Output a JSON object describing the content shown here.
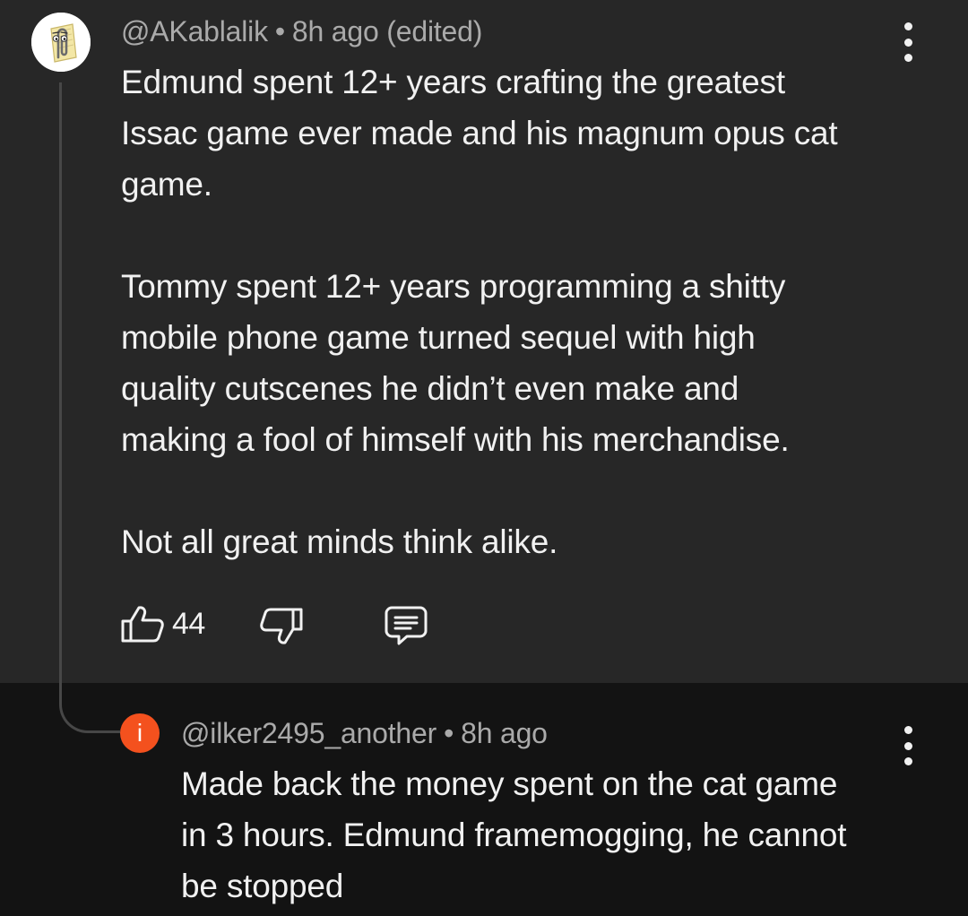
{
  "top_comment": {
    "author": "@AKablalik",
    "separator": "•",
    "timestamp": "8h ago (edited)",
    "avatar_icon": "paperclip-assistant-icon",
    "body_lines": [
      "Edmund spent 12+ years crafting the greatest",
      "Issac game ever made and his magnum opus cat",
      "game.",
      "",
      "Tommy spent 12+ years programming a shitty",
      "mobile phone game turned sequel with high",
      "quality cutscenes he didn’t even make and",
      "making a fool of himself with his merchandise.",
      "",
      "Not all great minds think alike."
    ],
    "like_count": "44",
    "icons": {
      "like": "thumb-up-icon",
      "dislike": "thumb-down-icon",
      "reply": "comment-reply-icon",
      "menu": "more-vert-icon"
    }
  },
  "reply": {
    "author": "@ilker2495_another",
    "separator": "•",
    "timestamp": "8h ago",
    "avatar_letter": "i",
    "avatar_color": "#f4511e",
    "body_lines": [
      "Made back the money spent on the cat game",
      "in 3 hours. Edmund framemogging, he cannot",
      "be stopped"
    ],
    "icons": {
      "menu": "more-vert-icon"
    }
  },
  "colors": {
    "top_background": "#272727",
    "reply_background": "#131313",
    "text_primary": "#f1f1f1",
    "text_secondary": "#aaaaaa",
    "thread_line": "#474747"
  }
}
